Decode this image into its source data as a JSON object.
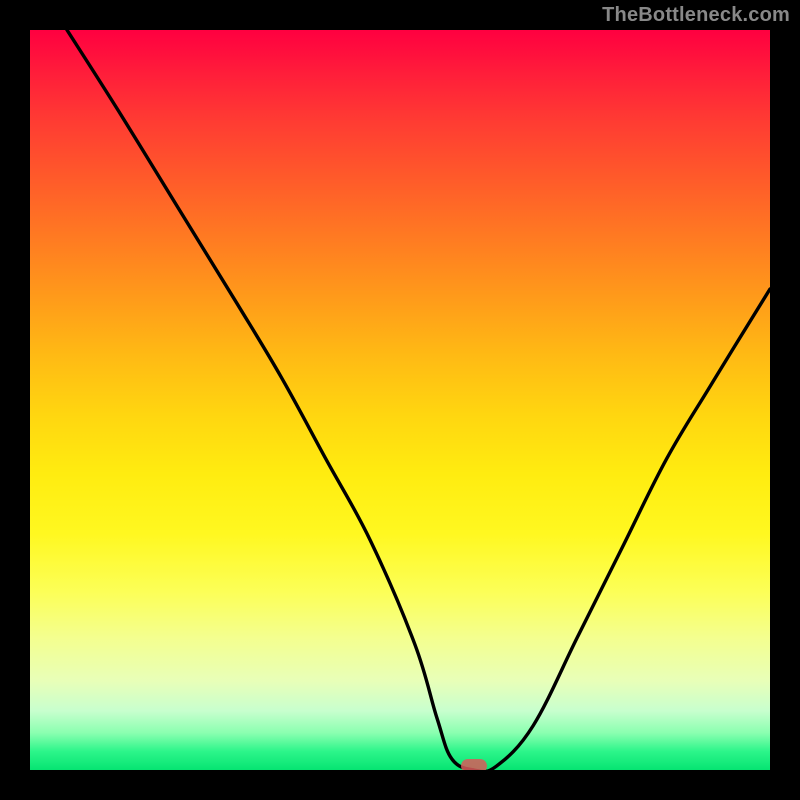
{
  "watermark": "TheBottleneck.com",
  "colors": {
    "marker": "#d85a5a",
    "curve": "#000000"
  },
  "chart_data": {
    "type": "line",
    "title": "",
    "xlabel": "",
    "ylabel": "",
    "xlim": [
      0,
      100
    ],
    "ylim": [
      0,
      100
    ],
    "grid": false,
    "legend": false,
    "description": "Bottleneck-style V curve on a vertical rainbow gradient (red at top = high bottleneck, green at bottom = low). Minimum occurs near x≈60 where the curve briefly flattens at y≈0. A small rounded red marker sits at the minimum.",
    "series": [
      {
        "name": "bottleneck-curve",
        "x": [
          5,
          12,
          20,
          28,
          34,
          40,
          46,
          52,
          55,
          57,
          60,
          63,
          68,
          74,
          80,
          86,
          92,
          100
        ],
        "y": [
          100,
          89,
          76,
          63,
          53,
          42,
          31,
          17,
          7,
          1.5,
          0,
          0.5,
          6,
          18,
          30,
          42,
          52,
          65
        ]
      }
    ],
    "marker": {
      "x": 60,
      "y": 0
    }
  }
}
